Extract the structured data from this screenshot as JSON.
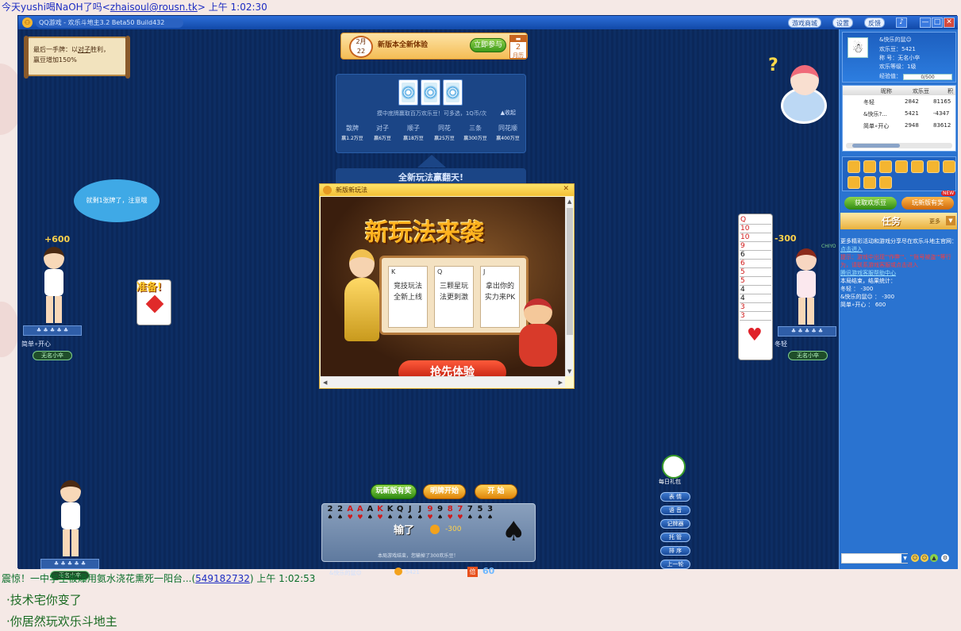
{
  "chat": {
    "line1_prefix": "今天yushi喝NaOH了吗<",
    "line1_email": "zhaisoul@rousn.tk",
    "line1_suffix": ">  上午 1:02:30",
    "line2_prefix": "震惊！一中学生被爆用氨水浇花熏死一阳台...(",
    "line2_qq": "549182732",
    "line2_suffix": ")  上午 1:02:53",
    "messages": [
      "技术宅你变了",
      "你居然玩欢乐斗地主"
    ]
  },
  "window": {
    "title": "QQ游戏 - 欢乐斗地主3.2 Beta50 Build432",
    "buttons": [
      "游戏商城",
      "设置",
      "反馈"
    ],
    "min": "—",
    "restore": "□",
    "close": "✕"
  },
  "notice": {
    "line1": "最后一手牌：以",
    "line1_u": "对子",
    "line1_end": "胜利，",
    "line2": "赢豆增加150%"
  },
  "event": {
    "month": "2月",
    "day": "22",
    "title": "新版本全新体验",
    "join": "立即参与",
    "cal_num": "2",
    "cal_label": "月历"
  },
  "jackpot": {
    "desc": "摸中底牌赢取百万欢乐豆！可多选，1Q币/次",
    "collapse": "▲收起",
    "columns": [
      {
        "name": "散牌",
        "prize": "赢1.2万豆"
      },
      {
        "name": "对子",
        "prize": "赢6万豆"
      },
      {
        "name": "顺子",
        "prize": "赢18万豆"
      },
      {
        "name": "同花",
        "prize": "赢25万豆"
      },
      {
        "name": "三条",
        "prize": "赢300万豆"
      },
      {
        "name": "同花顺",
        "prize": "赢400万豆"
      }
    ],
    "banner": "全新玩法赢翻天!"
  },
  "popup": {
    "title": "新版新玩法",
    "close": "✕",
    "heading": "新玩法来袭",
    "tiles": [
      {
        "rank": "K",
        "text1": "竞技玩法",
        "text2": "全新上线"
      },
      {
        "rank": "Q",
        "text1": "三颗星玩",
        "text2": "法更刺激"
      },
      {
        "rank": "J",
        "text1": "拿出你的",
        "text2": "实力来PK"
      }
    ],
    "grab": "抢先体验"
  },
  "players": {
    "left": {
      "name": "简单∘开心",
      "score": "+600",
      "rank": "无名小卒",
      "bubble": "就剩1张牌了，注意哦",
      "ready": "准备!"
    },
    "right": {
      "name": "冬轻",
      "score": "-300",
      "rank": "无名小卒",
      "tag": "CHIYO"
    },
    "me": {
      "name": "&快乐的鼠☺",
      "rank": "无名小卒",
      "beans": "5421"
    }
  },
  "right_stack_cards": [
    "Q",
    "10",
    "10",
    "9",
    "6",
    "6",
    "5",
    "5",
    "4",
    "4",
    "3",
    "3"
  ],
  "actions": {
    "new_mode": "玩新版有奖",
    "show_start": "明牌开始",
    "start": "开 始"
  },
  "side_buttons": [
    "表 情",
    "语 音",
    "记牌器",
    "托 管",
    "排 序",
    "上一轮"
  ],
  "daily_gift": "每日礼包",
  "hand": {
    "cards": [
      {
        "rank": "2",
        "suit": "♠",
        "color": "black"
      },
      {
        "rank": "2",
        "suit": "♠",
        "color": "black"
      },
      {
        "rank": "A",
        "suit": "♥",
        "color": "red"
      },
      {
        "rank": "A",
        "suit": "♥",
        "color": "red"
      },
      {
        "rank": "A",
        "suit": "♠",
        "color": "black"
      },
      {
        "rank": "K",
        "suit": "♥",
        "color": "red"
      },
      {
        "rank": "K",
        "suit": "♠",
        "color": "black"
      },
      {
        "rank": "Q",
        "suit": "♠",
        "color": "black"
      },
      {
        "rank": "J",
        "suit": "♠",
        "color": "black"
      },
      {
        "rank": "J",
        "suit": "♠",
        "color": "black"
      },
      {
        "rank": "9",
        "suit": "♥",
        "color": "red"
      },
      {
        "rank": "9",
        "suit": "♠",
        "color": "black"
      },
      {
        "rank": "8",
        "suit": "♥",
        "color": "red"
      },
      {
        "rank": "7",
        "suit": "♥",
        "color": "red"
      },
      {
        "rank": "7",
        "suit": "♠",
        "color": "black"
      },
      {
        "rank": "5",
        "suit": "♠",
        "color": "black"
      },
      {
        "rank": "3",
        "suit": "♠",
        "color": "black"
      }
    ],
    "lose": "输了",
    "lose_amount": "-300",
    "tip": "本局游戏结束，您输掉了300欢乐豆！",
    "mult_icon": "倍",
    "multiplier": "60"
  },
  "side": {
    "nickname": "&快乐的鼠☺",
    "beans": "欢乐豆：5421",
    "title": "称  号：无名小卒",
    "level": "欢乐等级：1级",
    "exp_label": "经验值：",
    "exp": "0/500",
    "table_headers": [
      "昵称",
      "欢乐豆",
      "积"
    ],
    "table_rows": [
      {
        "name": "冬轻",
        "beans": "2842",
        "score": "81165"
      },
      {
        "name": "&快乐?...",
        "beans": "5421",
        "score": "-4347"
      },
      {
        "name": "简单∘开心",
        "beans": "2948",
        "score": "83612"
      }
    ],
    "get_bean": "获取欢乐豆",
    "reward": "玩新版有奖",
    "new_badge": "NEW",
    "task": "任务",
    "more": "更多",
    "log": [
      {
        "text": "更多精彩活动和游戏分享尽在欢乐斗地主官网：",
        "cls": ""
      },
      {
        "text": "点击进入",
        "cls": "link"
      },
      {
        "text": "提示：游戏中出现\"'作弊'\"、\"'账号被盗'\"等行为，请联系游戏客服或点击进入",
        "cls": "red"
      },
      {
        "text": "腾讯游戏客服帮助中心",
        "cls": "link"
      },
      {
        "text": "本局结束，结果统计：",
        "cls": ""
      },
      {
        "text": "冬轻    ：  -300",
        "cls": ""
      },
      {
        "text": "&快乐的鼠☺ ：  -300",
        "cls": ""
      },
      {
        "text": "简单∘开心 ：  600",
        "cls": ""
      }
    ]
  }
}
